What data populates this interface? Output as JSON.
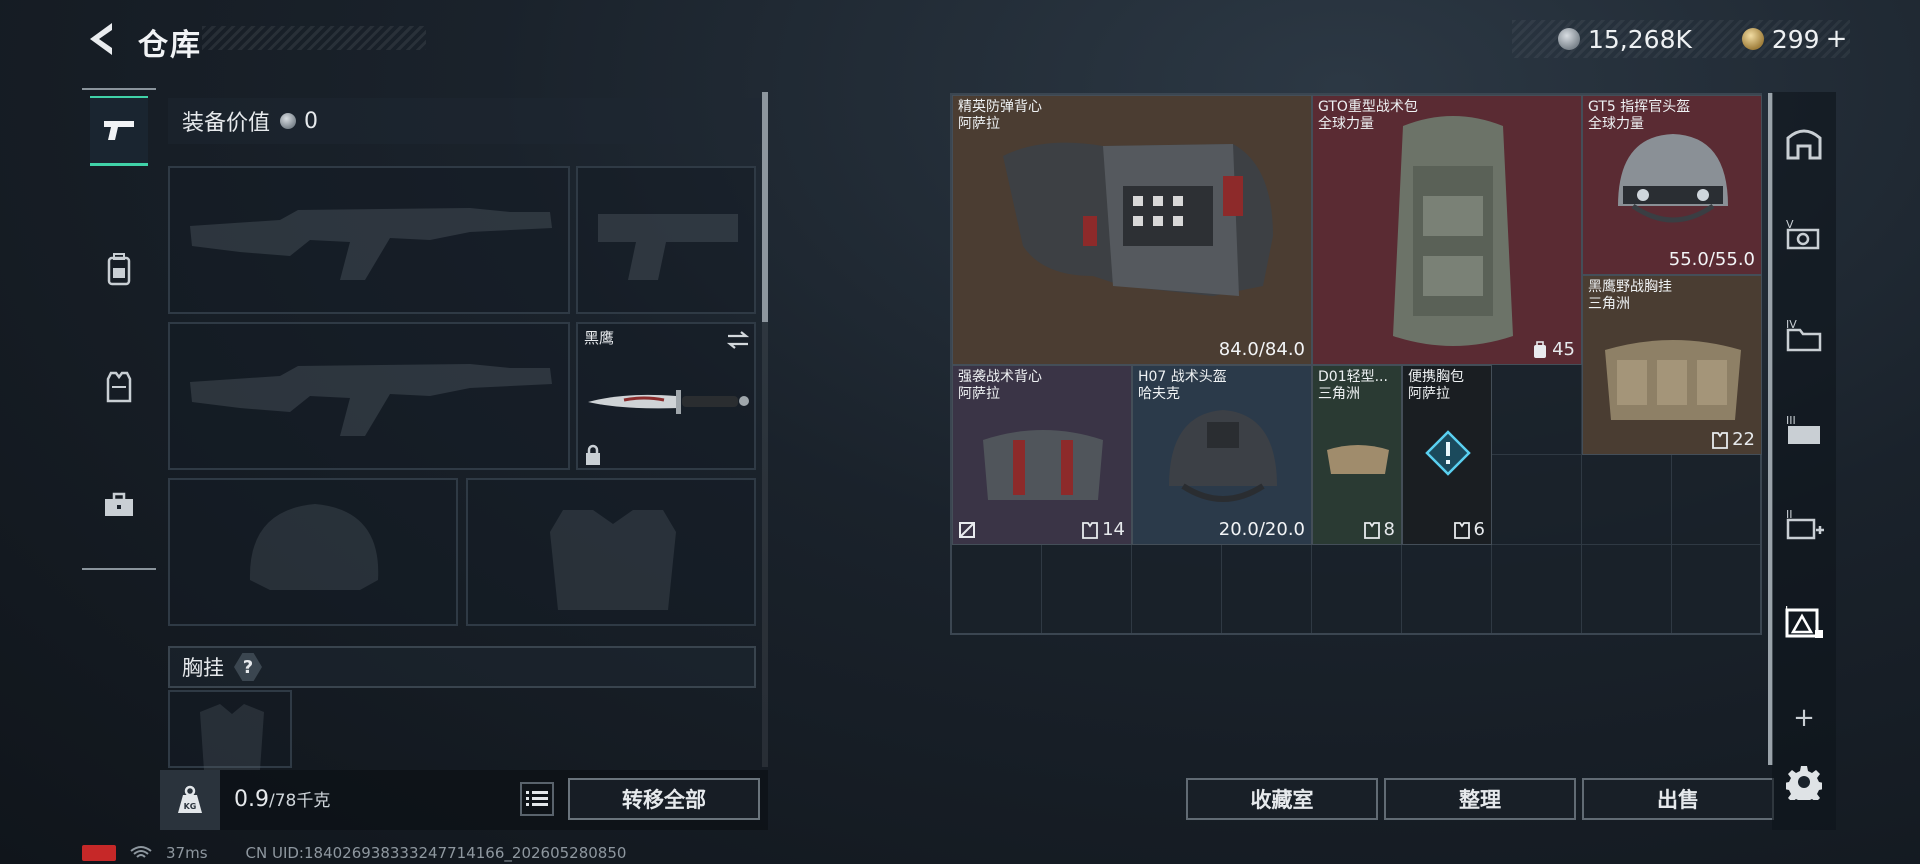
{
  "header": {
    "title": "仓库",
    "currency": [
      {
        "kind": "silver",
        "amount": "15,268K"
      },
      {
        "kind": "gold",
        "amount": "299"
      }
    ],
    "plus_label": "+"
  },
  "left_nav": {
    "tabs": [
      {
        "icon": "pistol-icon",
        "active": true
      },
      {
        "icon": "backpack-icon",
        "active": false
      },
      {
        "icon": "vest-icon",
        "active": false
      },
      {
        "icon": "briefcase-icon",
        "active": false
      }
    ]
  },
  "loadout": {
    "value_label": "装备价值",
    "value_amount": "0",
    "knife_label": "黑鹰",
    "chest_rig_label": "胸挂",
    "help_label": "?",
    "weight_current": "0.9",
    "weight_max": "/78千克",
    "transfer_all_label": "转移全部"
  },
  "stash": {
    "items": [
      {
        "name": "精英防弹背心\n阿萨拉",
        "value": "84.0/84.0",
        "value_kind": "durability",
        "color": "#4b3d32"
      },
      {
        "name": "GTO重型战术包\n全球力量",
        "value": "45",
        "value_kind": "capacity",
        "color": "#5a2b33"
      },
      {
        "name": "GT5 指挥官头盔\n全球力量",
        "value": "55.0/55.0",
        "value_kind": "durability",
        "color": "#5a2b33"
      },
      {
        "name": "黑鹰野战胸挂\n三角洲",
        "value": "22",
        "value_kind": "capacity",
        "color": "#4a3d32"
      },
      {
        "name": "强袭战术背心\n阿萨拉",
        "value": "14",
        "value_kind": "capacity",
        "color": "#3a3446"
      },
      {
        "name": "H07 战术头盔\n哈夫克",
        "value": "20.0/20.0",
        "value_kind": "durability",
        "color": "#2b3a4a"
      },
      {
        "name": "D01轻型...\n三角洲",
        "value": "8",
        "value_kind": "capacity",
        "color": "#2a3a33"
      },
      {
        "name": "便携胸包\n阿萨拉",
        "value": "6",
        "value_kind": "capacity",
        "color": "#1a1e22"
      }
    ],
    "buttons": [
      "收藏室",
      "整理",
      "出售"
    ]
  },
  "right_nav": {
    "icons": [
      "hideout-icon",
      "vault-camera-icon",
      "stash-folder-iv-icon",
      "stash-camera-icon",
      "stash-plus-ii-icon",
      "stash-warning-active-icon",
      "add-icon",
      "settings-gear-icon"
    ],
    "add_label": "+"
  },
  "status": {
    "ping": "37ms",
    "uid": "CN UID:184026938333247714166_202605280850"
  },
  "colors": {
    "accent": "#40d2a8",
    "durability_text": "#f2f4f6"
  }
}
